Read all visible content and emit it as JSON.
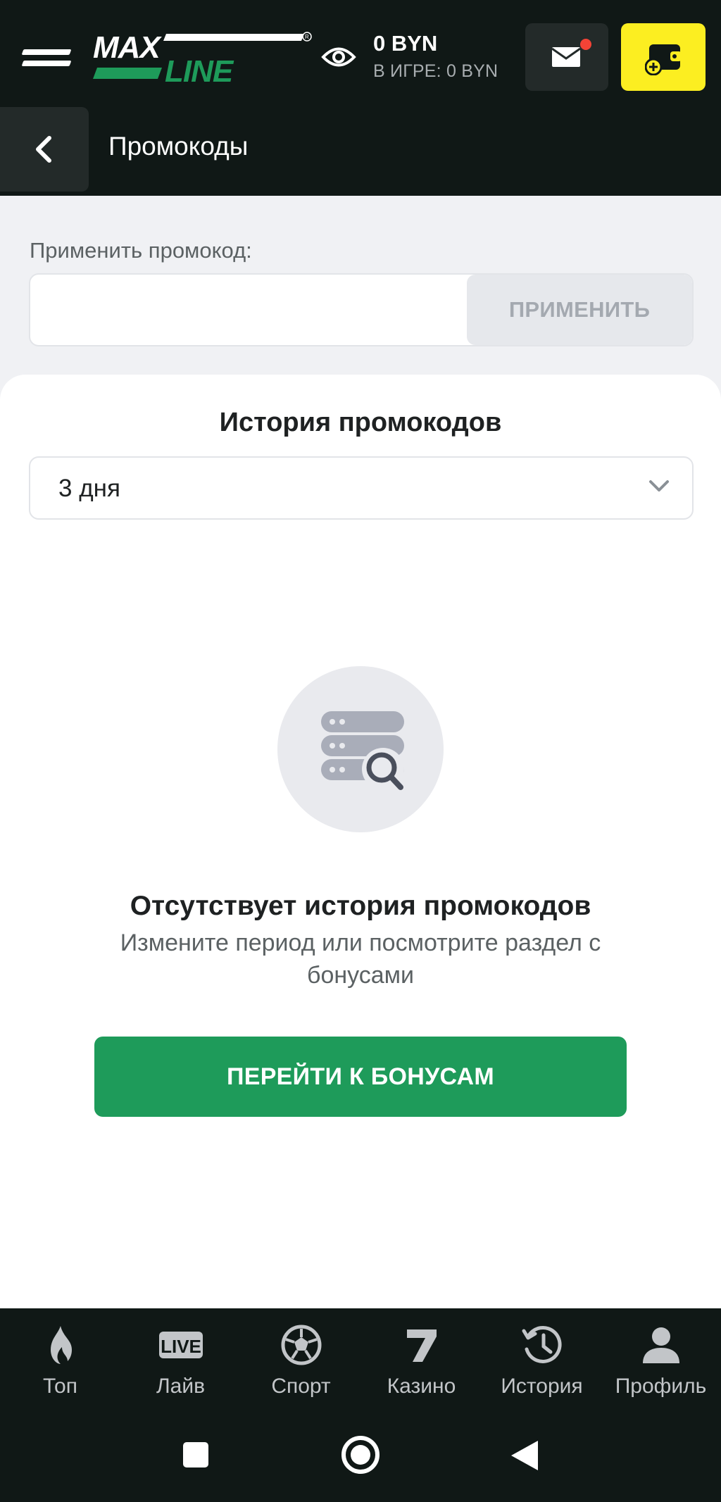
{
  "header": {
    "logo_text": "MAXLINE",
    "balance": "0 BYN",
    "in_game": "В ИГРЕ: 0 BYN",
    "icons": {
      "menu": "hamburger-icon",
      "eye": "eye-icon",
      "mail": "mail-icon",
      "wallet": "wallet-add-icon"
    },
    "notification_dot_color": "#f44336",
    "deposit_accent": "#fcee21"
  },
  "subheader": {
    "title": "Промокоды",
    "back_icon": "chevron-left-icon"
  },
  "promo": {
    "label": "Применить промокод:",
    "input_value": "",
    "input_placeholder": "",
    "apply_label": "ПРИМЕНИТЬ"
  },
  "history": {
    "title": "История промокодов",
    "period_selected": "3 дня",
    "empty_icon": "database-search-icon",
    "empty_title": "Отсутствует история промокодов",
    "empty_desc": "Измените период или посмотрите раздел с бонусами",
    "bonus_button": "ПЕРЕЙТИ К БОНУСАМ",
    "accent_color": "#1e9b5a"
  },
  "bottom_nav": {
    "items": [
      {
        "label": "Топ",
        "icon": "flame-icon"
      },
      {
        "label": "Лайв",
        "icon": "live-icon"
      },
      {
        "label": "Спорт",
        "icon": "soccer-ball-icon"
      },
      {
        "label": "Казино",
        "icon": "seven-icon"
      },
      {
        "label": "История",
        "icon": "history-icon"
      },
      {
        "label": "Профиль",
        "icon": "profile-icon"
      }
    ]
  },
  "system_nav": {
    "icons": [
      "recents-square-icon",
      "home-circle-icon",
      "back-triangle-icon"
    ]
  }
}
